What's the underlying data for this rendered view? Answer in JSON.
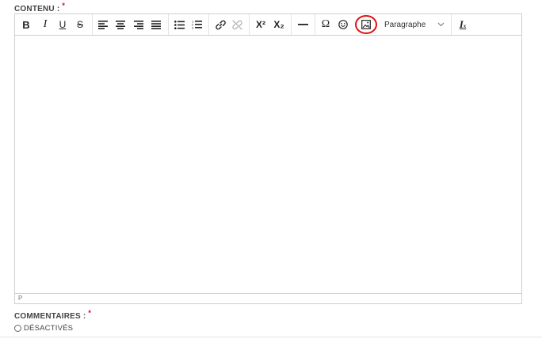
{
  "content_field": {
    "label": "CONTENU :",
    "required_mark": "*"
  },
  "toolbar": {
    "bold": "B",
    "italic": "I",
    "underline": "U",
    "strikethrough": "S",
    "superscript": "X²",
    "subscript": "X₂",
    "format_select": {
      "value": "Paragraphe"
    },
    "icons": [
      "bold-icon",
      "italic-icon",
      "underline-icon",
      "strikethrough-icon",
      "align-left-icon",
      "align-center-icon",
      "align-right-icon",
      "align-justify-icon",
      "bullet-list-icon",
      "numbered-list-icon",
      "link-icon",
      "unlink-icon",
      "superscript-icon",
      "subscript-icon",
      "horizontal-rule-icon",
      "omega-icon",
      "emoji-icon",
      "image-icon",
      "chevron-down-icon",
      "clear-formatting-icon"
    ],
    "highlight_color": "#e01010"
  },
  "editor": {
    "statusbar_path": "P"
  },
  "comments_field": {
    "label": "COMMENTAIRES :",
    "required_mark": "*",
    "option": "DÉSACTIVÉS"
  }
}
